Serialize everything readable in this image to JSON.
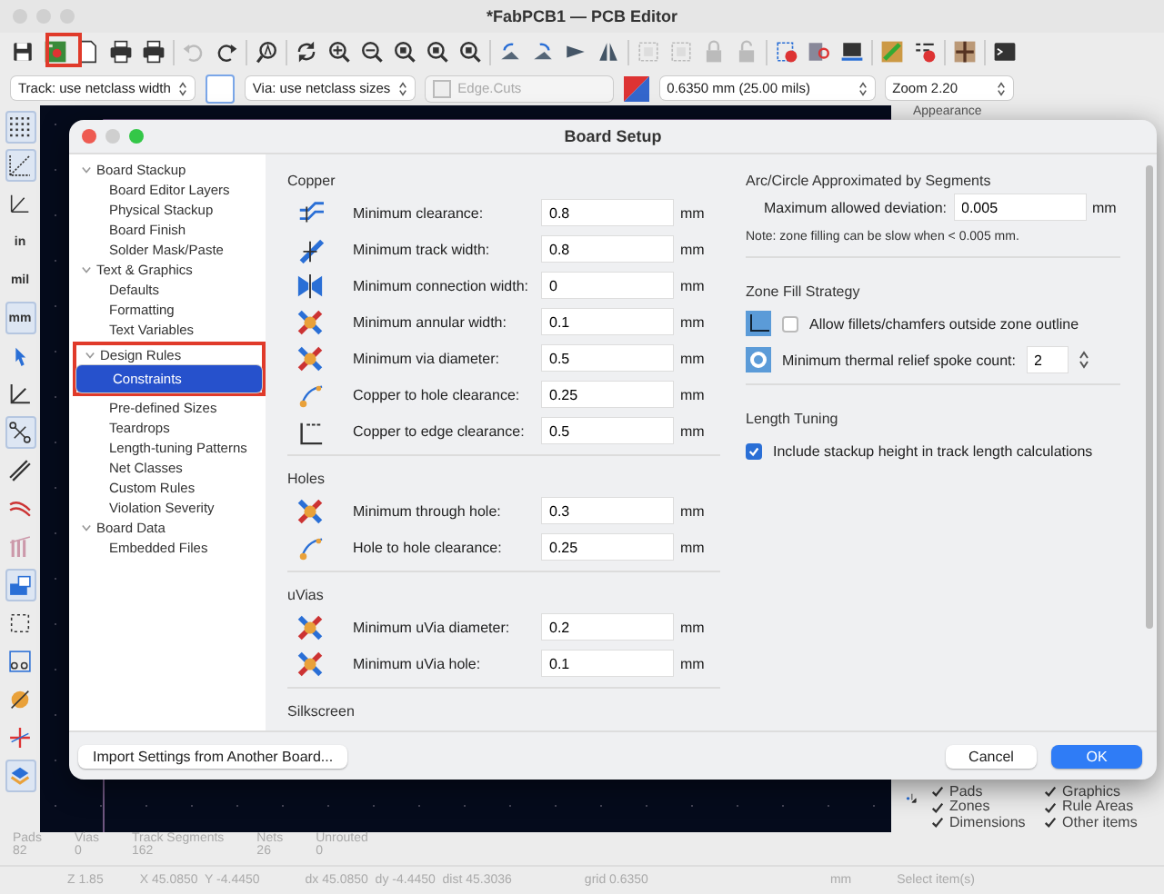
{
  "window": {
    "title": "*FabPCB1 — PCB Editor"
  },
  "toolbar2": {
    "track": "Track: use netclass width",
    "via": "Via: use netclass sizes",
    "layer": "Edge.Cuts",
    "grid": "0.6350 mm (25.00 mils)",
    "zoom": "Zoom 2.20"
  },
  "left_toolbar": [
    {
      "kind": "dots",
      "selected": true
    },
    {
      "kind": "grid",
      "selected": true
    },
    {
      "kind": "polar",
      "selected": false
    },
    {
      "kind": "unit",
      "label": "in",
      "selected": false
    },
    {
      "kind": "unit",
      "label": "mil",
      "selected": false
    },
    {
      "kind": "unit",
      "label": "mm",
      "selected": true
    },
    {
      "kind": "cursor",
      "selected": false
    },
    {
      "kind": "axes",
      "selected": false
    },
    {
      "kind": "ratsnest",
      "selected": true
    },
    {
      "kind": "tracks",
      "selected": false
    },
    {
      "kind": "curves",
      "selected": false
    },
    {
      "kind": "pins",
      "selected": false
    },
    {
      "kind": "layer",
      "selected": true
    },
    {
      "kind": "dashed",
      "selected": false
    },
    {
      "kind": "footprint",
      "selected": false
    },
    {
      "kind": "circle",
      "selected": false
    },
    {
      "kind": "cross",
      "selected": false
    },
    {
      "kind": "stack",
      "selected": true
    }
  ],
  "right_panel": {
    "tab": "Appearance",
    "items": [
      {
        "label": "Pads",
        "checked": true
      },
      {
        "label": "Graphics",
        "checked": true
      },
      {
        "label": "Zones",
        "checked": true
      },
      {
        "label": "Rule Areas",
        "checked": true
      },
      {
        "label": "Dimensions",
        "checked": true
      },
      {
        "label": "Other items",
        "checked": true
      }
    ]
  },
  "stats": [
    {
      "label": "Pads",
      "value": "82"
    },
    {
      "label": "Vias",
      "value": "0"
    },
    {
      "label": "Track Segments",
      "value": "162"
    },
    {
      "label": "Nets",
      "value": "26"
    },
    {
      "label": "Unrouted",
      "value": "0"
    }
  ],
  "status_bar": [
    "Z 1.85",
    "X 45.0850  Y -4.4450",
    "dx 45.0850  dy -4.4450  dist 45.3036",
    "grid 0.6350",
    "mm",
    "Select item(s)"
  ],
  "dialog": {
    "title": "Board Setup",
    "tree": [
      {
        "label": "Board Stackup",
        "expanded": true,
        "selected": false,
        "children": [
          {
            "label": "Board Editor Layers",
            "selected": false
          },
          {
            "label": "Physical Stackup",
            "selected": false
          },
          {
            "label": "Board Finish",
            "selected": false
          },
          {
            "label": "Solder Mask/Paste",
            "selected": false
          }
        ]
      },
      {
        "label": "Text & Graphics",
        "expanded": true,
        "selected": false,
        "children": [
          {
            "label": "Defaults",
            "selected": false
          },
          {
            "label": "Formatting",
            "selected": false
          },
          {
            "label": "Text Variables",
            "selected": false
          }
        ]
      },
      {
        "label": "Design Rules",
        "expanded": true,
        "selected": false,
        "framed": true,
        "children": [
          {
            "label": "Constraints",
            "selected": true
          },
          {
            "label": "Pre-defined Sizes",
            "selected": false
          },
          {
            "label": "Teardrops",
            "selected": false
          },
          {
            "label": "Length-tuning Patterns",
            "selected": false
          },
          {
            "label": "Net Classes",
            "selected": false
          },
          {
            "label": "Custom Rules",
            "selected": false
          },
          {
            "label": "Violation Severity",
            "selected": false
          }
        ]
      },
      {
        "label": "Board Data",
        "expanded": true,
        "selected": false,
        "children": [
          {
            "label": "Embedded Files",
            "selected": false
          }
        ]
      }
    ],
    "sections": [
      {
        "title": "Copper",
        "rows": [
          {
            "kind": "clearance",
            "label": "Minimum clearance:",
            "value": "0.8",
            "unit": "mm"
          },
          {
            "kind": "track",
            "label": "Minimum track width:",
            "value": "0.8",
            "unit": "mm"
          },
          {
            "kind": "connection",
            "label": "Minimum connection width:",
            "value": "0",
            "unit": "mm"
          },
          {
            "kind": "via",
            "label": "Minimum annular width:",
            "value": "0.1",
            "unit": "mm"
          },
          {
            "kind": "via",
            "label": "Minimum via diameter:",
            "value": "0.5",
            "unit": "mm"
          },
          {
            "kind": "hole",
            "label": "Copper to hole clearance:",
            "value": "0.25",
            "unit": "mm"
          },
          {
            "kind": "edge",
            "label": "Copper to edge clearance:",
            "value": "0.5",
            "unit": "mm"
          }
        ]
      },
      {
        "title": "Holes",
        "rows": [
          {
            "kind": "via",
            "label": "Minimum through hole:",
            "value": "0.3",
            "unit": "mm"
          },
          {
            "kind": "hole",
            "label": "Hole to hole clearance:",
            "value": "0.25",
            "unit": "mm"
          }
        ]
      },
      {
        "title": "uVias",
        "rows": [
          {
            "kind": "via",
            "label": "Minimum uVia diameter:",
            "value": "0.2",
            "unit": "mm"
          },
          {
            "kind": "via",
            "label": "Minimum uVia hole:",
            "value": "0.1",
            "unit": "mm"
          }
        ]
      },
      {
        "title": "Silkscreen"
      }
    ],
    "arc": {
      "title": "Arc/Circle Approximated by Segments",
      "label": "Maximum allowed deviation:",
      "value": "0.005",
      "unit": "mm",
      "note": "Note: zone filling can be slow when < 0.005 mm."
    },
    "zone": {
      "title": "Zone Fill Strategy",
      "checkbox": {
        "label": "Allow fillets/chamfers outside zone outline",
        "checked": false
      },
      "spin": {
        "label": "Minimum thermal relief spoke count:",
        "value": "2"
      }
    },
    "tuning": {
      "title": "Length Tuning",
      "checkbox": {
        "label": "Include stackup height in track length calculations",
        "checked": true
      }
    },
    "buttons": {
      "import": "Import Settings from Another Board...",
      "cancel": "Cancel",
      "ok": "OK"
    }
  }
}
